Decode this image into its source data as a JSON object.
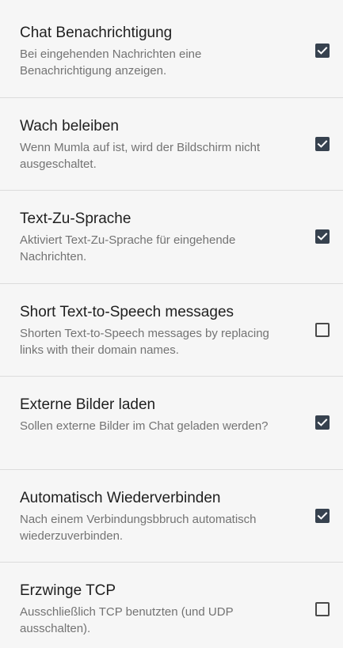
{
  "settings": [
    {
      "title": "Chat Benachrichtigung",
      "summary": "Bei eingehenden Nachrichten eine Benachrichtigung anzeigen.",
      "checked": true
    },
    {
      "title": "Wach beleiben",
      "summary": "Wenn Mumla auf ist, wird der Bildschirm nicht ausgeschaltet.",
      "checked": true
    },
    {
      "title": "Text-Zu-Sprache",
      "summary": "Aktiviert Text-Zu-Sprache für eingehende Nachrichten.",
      "checked": true
    },
    {
      "title": "Short Text-to-Speech messages",
      "summary": "Shorten Text-to-Speech messages by replacing links with their domain names.",
      "checked": false
    },
    {
      "title": "Externe Bilder laden",
      "summary": "Sollen externe Bilder im Chat geladen werden?",
      "checked": true
    },
    {
      "title": "Automatisch Wiederverbinden",
      "summary": "Nach einem Verbindungsbbruch automatisch wiederzuverbinden.",
      "checked": true
    },
    {
      "title": "Erzwinge TCP",
      "summary": "Ausschließlich TCP benutzten (und UDP ausschalten).",
      "checked": false
    }
  ],
  "colors": {
    "checkbox_checked": "#37424f",
    "checkbox_unchecked_border": "#4a4a4a",
    "title_text": "#1f1f1f",
    "summary_text": "#737373",
    "background": "#f6f6f6"
  },
  "icons": {
    "checked": "check-icon"
  }
}
